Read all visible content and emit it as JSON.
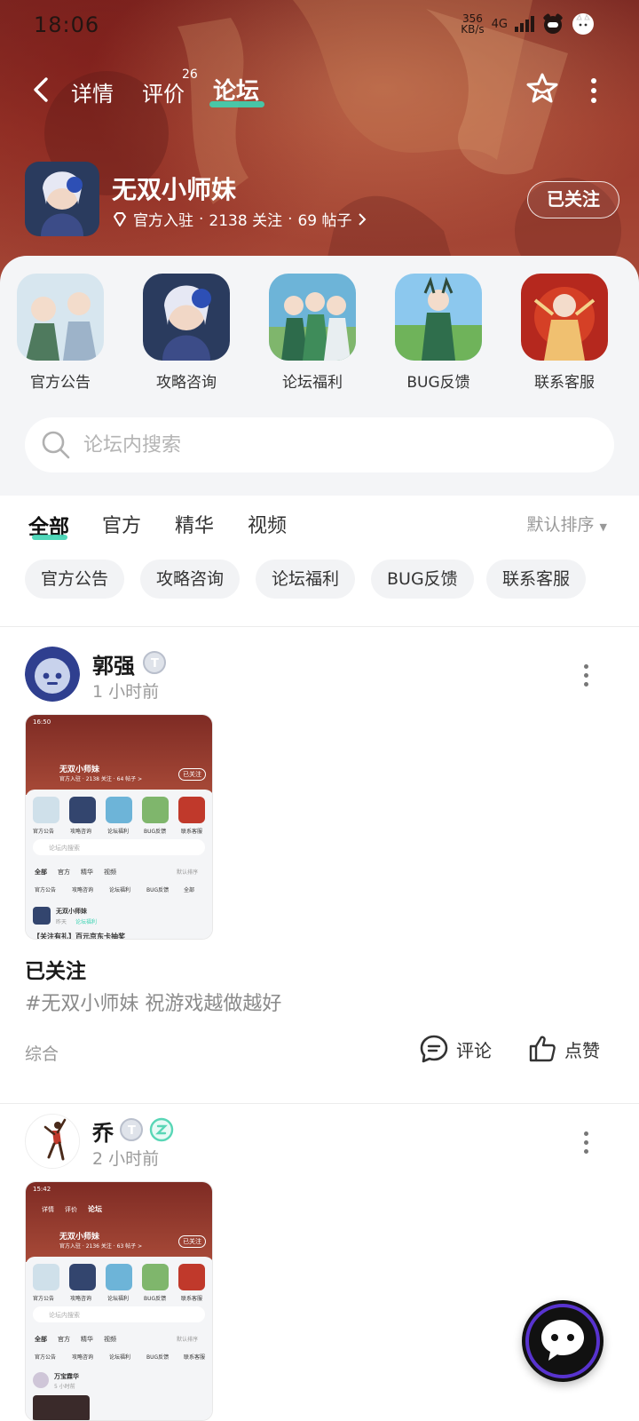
{
  "status_bar": {
    "time": "18:06",
    "net_speed": "356\nKB/s",
    "net_type": "4G"
  },
  "nav": {
    "tab_detail": "详情",
    "tab_review": "评价",
    "review_count": "26",
    "tab_forum": "论坛"
  },
  "game": {
    "name": "无双小师妹",
    "official": "官方入驻",
    "followers": "2138 关注",
    "posts": "69 帖子",
    "follow_label": "已关注"
  },
  "shortcuts": [
    {
      "label": "官方公告"
    },
    {
      "label": "攻略咨询"
    },
    {
      "label": "论坛福利"
    },
    {
      "label": "BUG反馈"
    },
    {
      "label": "联系客服"
    }
  ],
  "search": {
    "placeholder": "论坛内搜索"
  },
  "filters": {
    "tabs": [
      "全部",
      "官方",
      "精华",
      "视频"
    ],
    "sort": "默认排序",
    "chips": [
      "官方公告",
      "攻略咨询",
      "论坛福利",
      "BUG反馈",
      "联系客服"
    ]
  },
  "posts": [
    {
      "user": "郭强",
      "time": "1 小时前",
      "title": "已关注",
      "text": "#无双小师妹 祝游戏越做越好",
      "category": "综合",
      "comment_label": "评论",
      "like_label": "点赞",
      "mini": {
        "time": "16:50",
        "game": "无双小师妹",
        "meta": "官方入驻 · 2138 关注 · 64 帖子 >",
        "follow": "已关注",
        "labels": [
          "官方公告",
          "攻略咨询",
          "论坛福利",
          "BUG反馈",
          "联系客服"
        ],
        "search": "论坛内搜索",
        "tabs": [
          "全部",
          "官方",
          "精华",
          "视频"
        ],
        "sort": "默认排序",
        "chips": [
          "官方公告",
          "攻略咨询",
          "论坛福利",
          "BUG反馈",
          "全部"
        ],
        "post_user": "无双小师妹",
        "post_time": "昨天",
        "post_tag": "论坛福利",
        "post_title": "【关注有礼】百元京东卡抽奖"
      }
    },
    {
      "user": "乔",
      "time": "2 小时前",
      "mini": {
        "time": "15:42",
        "tab_detail": "详情",
        "tab_review": "评价",
        "tab_forum": "论坛",
        "game": "无双小师妹",
        "meta": "官方入驻 · 2136 关注 · 63 帖子 >",
        "follow": "已关注",
        "labels": [
          "官方公告",
          "攻略咨询",
          "论坛福利",
          "BUG反馈",
          "联系客服"
        ],
        "search": "论坛内搜索",
        "tabs": [
          "全部",
          "官方",
          "精华",
          "视频"
        ],
        "sort": "默认排序",
        "chips": [
          "官方公告",
          "攻略咨询",
          "论坛福利",
          "BUG反馈",
          "联系客服"
        ],
        "post_user": "万宝霖华",
        "post_time": "5 小时前"
      }
    }
  ],
  "colors": {
    "accent": "#3ed3b3",
    "header": "#9c3a2c"
  }
}
